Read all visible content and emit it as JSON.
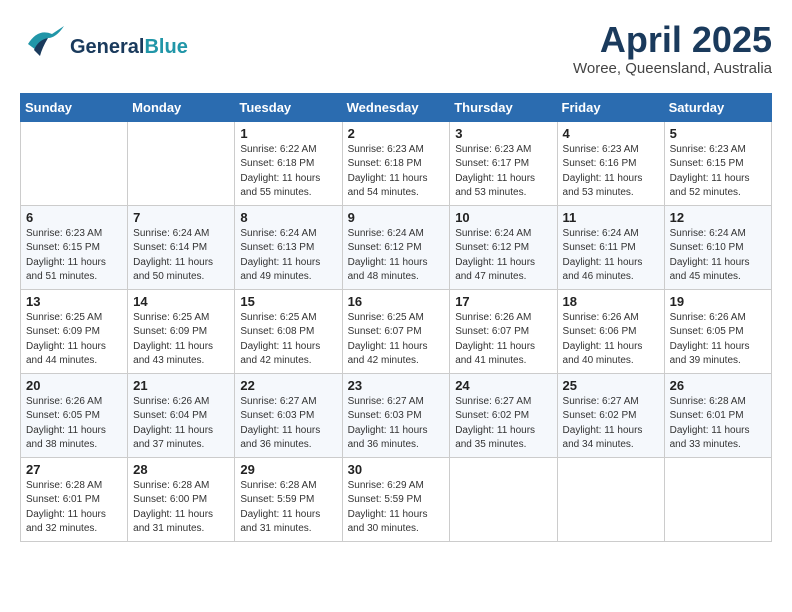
{
  "header": {
    "logo_general": "General",
    "logo_blue": "Blue",
    "month_title": "April 2025",
    "subtitle": "Woree, Queensland, Australia"
  },
  "weekdays": [
    "Sunday",
    "Monday",
    "Tuesday",
    "Wednesday",
    "Thursday",
    "Friday",
    "Saturday"
  ],
  "weeks": [
    [
      {
        "day": "",
        "info": ""
      },
      {
        "day": "",
        "info": ""
      },
      {
        "day": "1",
        "info": "Sunrise: 6:22 AM\nSunset: 6:18 PM\nDaylight: 11 hours\nand 55 minutes."
      },
      {
        "day": "2",
        "info": "Sunrise: 6:23 AM\nSunset: 6:18 PM\nDaylight: 11 hours\nand 54 minutes."
      },
      {
        "day": "3",
        "info": "Sunrise: 6:23 AM\nSunset: 6:17 PM\nDaylight: 11 hours\nand 53 minutes."
      },
      {
        "day": "4",
        "info": "Sunrise: 6:23 AM\nSunset: 6:16 PM\nDaylight: 11 hours\nand 53 minutes."
      },
      {
        "day": "5",
        "info": "Sunrise: 6:23 AM\nSunset: 6:15 PM\nDaylight: 11 hours\nand 52 minutes."
      }
    ],
    [
      {
        "day": "6",
        "info": "Sunrise: 6:23 AM\nSunset: 6:15 PM\nDaylight: 11 hours\nand 51 minutes."
      },
      {
        "day": "7",
        "info": "Sunrise: 6:24 AM\nSunset: 6:14 PM\nDaylight: 11 hours\nand 50 minutes."
      },
      {
        "day": "8",
        "info": "Sunrise: 6:24 AM\nSunset: 6:13 PM\nDaylight: 11 hours\nand 49 minutes."
      },
      {
        "day": "9",
        "info": "Sunrise: 6:24 AM\nSunset: 6:12 PM\nDaylight: 11 hours\nand 48 minutes."
      },
      {
        "day": "10",
        "info": "Sunrise: 6:24 AM\nSunset: 6:12 PM\nDaylight: 11 hours\nand 47 minutes."
      },
      {
        "day": "11",
        "info": "Sunrise: 6:24 AM\nSunset: 6:11 PM\nDaylight: 11 hours\nand 46 minutes."
      },
      {
        "day": "12",
        "info": "Sunrise: 6:24 AM\nSunset: 6:10 PM\nDaylight: 11 hours\nand 45 minutes."
      }
    ],
    [
      {
        "day": "13",
        "info": "Sunrise: 6:25 AM\nSunset: 6:09 PM\nDaylight: 11 hours\nand 44 minutes."
      },
      {
        "day": "14",
        "info": "Sunrise: 6:25 AM\nSunset: 6:09 PM\nDaylight: 11 hours\nand 43 minutes."
      },
      {
        "day": "15",
        "info": "Sunrise: 6:25 AM\nSunset: 6:08 PM\nDaylight: 11 hours\nand 42 minutes."
      },
      {
        "day": "16",
        "info": "Sunrise: 6:25 AM\nSunset: 6:07 PM\nDaylight: 11 hours\nand 42 minutes."
      },
      {
        "day": "17",
        "info": "Sunrise: 6:26 AM\nSunset: 6:07 PM\nDaylight: 11 hours\nand 41 minutes."
      },
      {
        "day": "18",
        "info": "Sunrise: 6:26 AM\nSunset: 6:06 PM\nDaylight: 11 hours\nand 40 minutes."
      },
      {
        "day": "19",
        "info": "Sunrise: 6:26 AM\nSunset: 6:05 PM\nDaylight: 11 hours\nand 39 minutes."
      }
    ],
    [
      {
        "day": "20",
        "info": "Sunrise: 6:26 AM\nSunset: 6:05 PM\nDaylight: 11 hours\nand 38 minutes."
      },
      {
        "day": "21",
        "info": "Sunrise: 6:26 AM\nSunset: 6:04 PM\nDaylight: 11 hours\nand 37 minutes."
      },
      {
        "day": "22",
        "info": "Sunrise: 6:27 AM\nSunset: 6:03 PM\nDaylight: 11 hours\nand 36 minutes."
      },
      {
        "day": "23",
        "info": "Sunrise: 6:27 AM\nSunset: 6:03 PM\nDaylight: 11 hours\nand 36 minutes."
      },
      {
        "day": "24",
        "info": "Sunrise: 6:27 AM\nSunset: 6:02 PM\nDaylight: 11 hours\nand 35 minutes."
      },
      {
        "day": "25",
        "info": "Sunrise: 6:27 AM\nSunset: 6:02 PM\nDaylight: 11 hours\nand 34 minutes."
      },
      {
        "day": "26",
        "info": "Sunrise: 6:28 AM\nSunset: 6:01 PM\nDaylight: 11 hours\nand 33 minutes."
      }
    ],
    [
      {
        "day": "27",
        "info": "Sunrise: 6:28 AM\nSunset: 6:01 PM\nDaylight: 11 hours\nand 32 minutes."
      },
      {
        "day": "28",
        "info": "Sunrise: 6:28 AM\nSunset: 6:00 PM\nDaylight: 11 hours\nand 31 minutes."
      },
      {
        "day": "29",
        "info": "Sunrise: 6:28 AM\nSunset: 5:59 PM\nDaylight: 11 hours\nand 31 minutes."
      },
      {
        "day": "30",
        "info": "Sunrise: 6:29 AM\nSunset: 5:59 PM\nDaylight: 11 hours\nand 30 minutes."
      },
      {
        "day": "",
        "info": ""
      },
      {
        "day": "",
        "info": ""
      },
      {
        "day": "",
        "info": ""
      }
    ]
  ]
}
